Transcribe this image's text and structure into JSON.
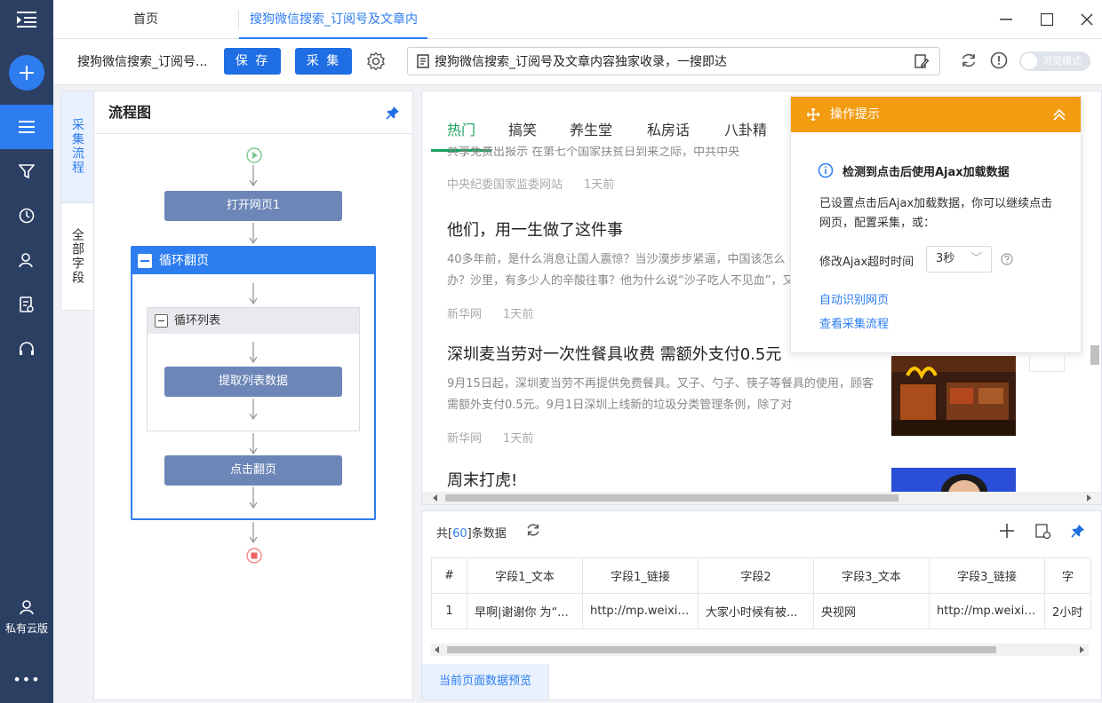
{
  "sidebar": {
    "user_label": "私有云版",
    "more_label": "•••",
    "accent": "#2d7df0"
  },
  "tabs": {
    "home": "首页",
    "active": "搜狗微信搜索_订阅号及文章内"
  },
  "toolbar": {
    "task_name": "搜狗微信搜索_订阅号...",
    "save_label": "保 存",
    "collect_label": "采 集",
    "url": "搜狗微信搜索_订阅号及文章内容独家收录，一搜即达",
    "browse_mode_label": "浏览模式"
  },
  "side_tabs": {
    "flow": "采集流程",
    "fields": "全部字段"
  },
  "flow": {
    "title": "流程图",
    "open_page": "打开网页1",
    "loop_page": "循环翻页",
    "loop_list": "循环列表",
    "extract": "提取列表数据",
    "click_page": "点击翻页"
  },
  "browser": {
    "nav": [
      "热门",
      "搞笑",
      "养生堂",
      "私房话",
      "八卦精"
    ],
    "top_snippet": "共享免费出报示     在第七个国家扶贫日到来之际，中共中央",
    "top_meta": {
      "source": "中央纪委国家监委网站",
      "time": "1天前"
    },
    "articles": [
      {
        "title": "他们，用一生做了这件事",
        "body": "40多年前，是什么消息让国人震惊？当沙漠步步紧逼，中国该怎么办？沙里，有多少人的辛酸往事？他为什么说“沙子吃人不见血”，又",
        "source": "新华网",
        "time": "1天前"
      },
      {
        "title": "深圳麦当劳对一次性餐具收费 需额外支付0.5元",
        "body": "9月15日起，深圳麦当劳不再提供免费餐具。叉子、勺子、筷子等餐具的使用，顾客需额外支付0.5元。9月1日深圳上线新的垃圾分类管理条例，除了对",
        "source": "新华网",
        "time": "1天前"
      },
      {
        "title": "周末打虎!"
      }
    ]
  },
  "tip": {
    "title": "操作提示",
    "info": "检测到点击后使用Ajax加载数据",
    "desc": "已设置点击后Ajax加载数据，你可以继续点击网页，配置采集，或：",
    "timeout_label": "修改Ajax超时时间",
    "timeout_value": "3秒",
    "link_auto": "自动识别网页",
    "link_flow": "查看采集流程",
    "color": "#f39c12"
  },
  "data": {
    "count_prefix": "共[",
    "count": "60",
    "count_suffix": "]条数据",
    "columns": [
      "#",
      "字段1_文本",
      "字段1_链接",
      "字段2",
      "字段3_文本",
      "字段3_链接",
      "字"
    ],
    "rows": [
      [
        "1",
        "早啊|谢谢你 为“...",
        "http://mp.weixin...",
        "大家小时候有被...",
        "央视网",
        "http://mp.weixin...",
        "2小时"
      ]
    ],
    "preview_tab": "当前页面数据预览"
  }
}
